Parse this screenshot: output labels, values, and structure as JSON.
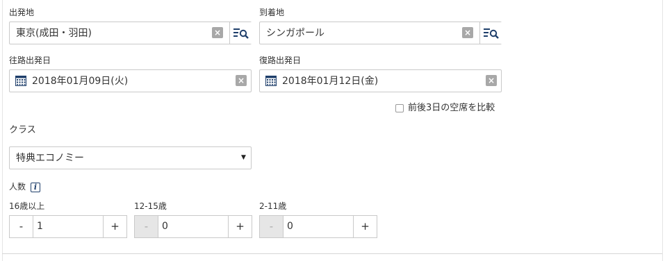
{
  "origin": {
    "label": "出発地",
    "value": "東京(成田・羽田)"
  },
  "destination": {
    "label": "到着地",
    "value": "シンガポール"
  },
  "outbound": {
    "label": "往路出発日",
    "value": "2018年01月09日(火)"
  },
  "return": {
    "label": "復路出発日",
    "value": "2018年01月12日(金)"
  },
  "compare": {
    "label": "前後3日の空席を比較",
    "checked": false
  },
  "cabin": {
    "label": "クラス",
    "value": "特典エコノミー"
  },
  "passengers": {
    "label": "人数",
    "groups": [
      {
        "label": "16歳以上",
        "value": "1",
        "minus": "-",
        "plus": "+"
      },
      {
        "label": "12-15歳",
        "value": "0",
        "minus": "-",
        "plus": "+"
      },
      {
        "label": "2-11歳",
        "value": "0",
        "minus": "-",
        "plus": "+"
      }
    ]
  },
  "icons": {
    "clear": "×",
    "info": "i",
    "dropdown": "▼"
  }
}
